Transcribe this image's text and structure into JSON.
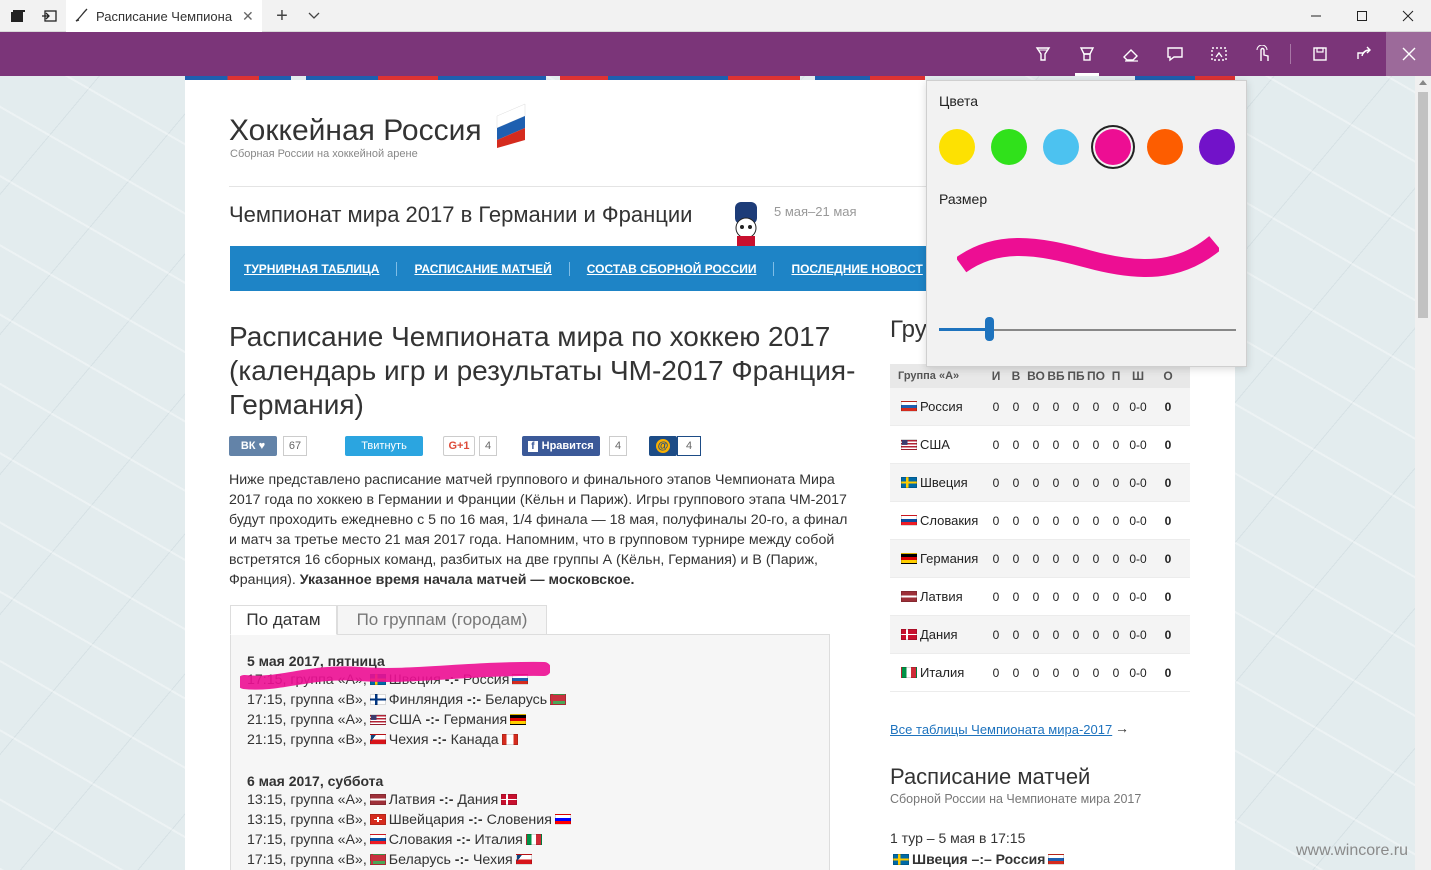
{
  "browser": {
    "tab_title": "Расписание Чемпиона",
    "tab_close": "✕",
    "new_tab": "+",
    "tab_menu": "⌄"
  },
  "ink_toolbar": {
    "buttons": [
      "ballpoint-pen",
      "highlighter",
      "eraser",
      "comment",
      "clip",
      "touch-writing",
      "save",
      "share"
    ],
    "active": "highlighter",
    "close": "✕"
  },
  "site": {
    "title": "Хоккейная Россия",
    "subtitle": "Сборная России на хоккейной арене",
    "championship": "Чемпионат мира 2017 в Германии и Франции",
    "dates": "5 мая–21 мая"
  },
  "nav": [
    "ТУРНИРНАЯ ТАБЛИЦА",
    "РАСПИСАНИЕ МАТЧЕЙ",
    "СОСТАВ СБОРНОЙ РОССИИ",
    "ПОСЛЕДНИЕ НОВОСТ"
  ],
  "article": {
    "heading": "Расписание Чемпионата мира по хоккею 2017 (календарь игр и результаты ЧМ-2017 Франция-Германия)",
    "intro": "Ниже представлено расписание матчей группового и финального этапов Чемпионата Мира 2017 года по хоккею в Германии и Франции (Кёльн и Париж). Игры группового этапа ЧМ-2017 будут проходить ежедневно с 5 по 16 мая, 1/4 финала — 18 мая, полуфиналы 20-го, а финал и матч за третье место 21 мая 2017 года. Напомним, что в групповом турнире между собой встретятся 16 сборных команд, разбитых на две группы А (Кёльн, Германия) и В (Париж, Франция).",
    "intro_bold": "Указанное время начала матчей — московское."
  },
  "shares": {
    "vk": "ВК",
    "vk_count": "67",
    "twitter": "Твитнуть",
    "gplus": "G+1",
    "gplus_count": "4",
    "fb": "Нравится",
    "fb_count": "4",
    "mail": "@",
    "mail_count": "4"
  },
  "tabs": {
    "by_date": "По датам",
    "by_group": "По группам (городам)"
  },
  "schedule": [
    {
      "day": "5 мая 2017, пятница",
      "games": [
        {
          "time": "17:15, группа «А»,",
          "home": "Швеция",
          "sep": "-:-",
          "away": "Россия",
          "hf": "se",
          "af": "ru"
        },
        {
          "time": "17:15, группа «В»,",
          "home": "Финляндия",
          "sep": "-:-",
          "away": "Беларусь",
          "hf": "fi",
          "af": "by"
        },
        {
          "time": "21:15, группа «А»,",
          "home": "США",
          "sep": "-:-",
          "away": "Германия",
          "hf": "us",
          "af": "de"
        },
        {
          "time": "21:15, группа «В»,",
          "home": "Чехия",
          "sep": "-:-",
          "away": "Канада",
          "hf": "cz",
          "af": "ca"
        }
      ]
    },
    {
      "day": "6 мая 2017, суббота",
      "games": [
        {
          "time": "13:15, группа «А»,",
          "home": "Латвия",
          "sep": "-:-",
          "away": "Дания",
          "hf": "lv",
          "af": "dk"
        },
        {
          "time": "13:15, группа «В»,",
          "home": "Швейцария",
          "sep": "-:-",
          "away": "Словения",
          "hf": "ch",
          "af": "si"
        },
        {
          "time": "17:15, группа «А»,",
          "home": "Словакия",
          "sep": "-:-",
          "away": "Италия",
          "hf": "sk",
          "af": "it"
        },
        {
          "time": "17:15, группа «В»,",
          "home": "Беларусь",
          "sep": "-:-",
          "away": "Чехия",
          "hf": "by",
          "af": "cz"
        }
      ]
    }
  ],
  "group": {
    "heading": "Гру",
    "columns": [
      "Группа «А»",
      "И",
      "В",
      "ВО",
      "ВБ",
      "ПБ",
      "ПО",
      "П",
      "Ш",
      "О"
    ],
    "rows": [
      {
        "team": "Россия",
        "flag": "ru",
        "vals": [
          "0",
          "0",
          "0",
          "0",
          "0",
          "0",
          "0",
          "0-0",
          "0"
        ]
      },
      {
        "team": "США",
        "flag": "us",
        "vals": [
          "0",
          "0",
          "0",
          "0",
          "0",
          "0",
          "0",
          "0-0",
          "0"
        ]
      },
      {
        "team": "Швеция",
        "flag": "se",
        "vals": [
          "0",
          "0",
          "0",
          "0",
          "0",
          "0",
          "0",
          "0-0",
          "0"
        ]
      },
      {
        "team": "Словакия",
        "flag": "sk",
        "vals": [
          "0",
          "0",
          "0",
          "0",
          "0",
          "0",
          "0",
          "0-0",
          "0"
        ]
      },
      {
        "team": "Германия",
        "flag": "de",
        "vals": [
          "0",
          "0",
          "0",
          "0",
          "0",
          "0",
          "0",
          "0-0",
          "0"
        ]
      },
      {
        "team": "Латвия",
        "flag": "lv",
        "vals": [
          "0",
          "0",
          "0",
          "0",
          "0",
          "0",
          "0",
          "0-0",
          "0"
        ]
      },
      {
        "team": "Дания",
        "flag": "dk",
        "vals": [
          "0",
          "0",
          "0",
          "0",
          "0",
          "0",
          "0",
          "0-0",
          "0"
        ]
      },
      {
        "team": "Италия",
        "flag": "it",
        "vals": [
          "0",
          "0",
          "0",
          "0",
          "0",
          "0",
          "0",
          "0-0",
          "0"
        ]
      }
    ],
    "all_tables": "Все таблицы Чемпионата мира-2017",
    "arrow": "→"
  },
  "sidebar_schedule": {
    "heading": "Расписание матчей",
    "sub": "Сборной России на Чемпионате мира 2017",
    "round": "1 тур – 5 мая в 17:15",
    "match": "Швеция –:– Россия"
  },
  "pen_popup": {
    "colors_label": "Цвета",
    "size_label": "Размер",
    "colors": [
      "#fde102",
      "#30e11b",
      "#4cc2f0",
      "#ed0e93",
      "#fd5d00",
      "#7212c9"
    ],
    "selected_color": "#ed0e93",
    "size_fraction": 0.17
  },
  "watermark": "www.wincore.ru",
  "colors": {
    "accent": "#7b3579",
    "nav": "#1e84c6",
    "ink": "#ed0e93"
  }
}
